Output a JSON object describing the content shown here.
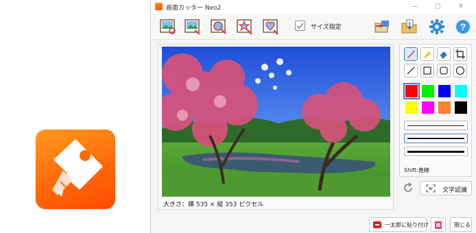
{
  "window": {
    "title": "画面カッター Neo2",
    "minimize_glyph": "—",
    "maximize_glyph": "▢",
    "close_glyph": "✕"
  },
  "toolbar": {
    "buttons": [
      {
        "name": "capture-screen-icon"
      },
      {
        "name": "capture-window-icon"
      },
      {
        "name": "capture-region-icon"
      },
      {
        "name": "capture-star-icon"
      },
      {
        "name": "capture-heart-icon"
      },
      {
        "name": "export-image-icon"
      },
      {
        "name": "save-folder-icon"
      },
      {
        "name": "settings-gear-icon"
      },
      {
        "name": "help-icon"
      }
    ],
    "size_fixed_label": "サイズ指定",
    "size_fixed_checked": true,
    "help_glyph": "?"
  },
  "preview": {
    "size_info": "大きさ：横 535 × 縦 353 ピクセル"
  },
  "panel": {
    "tools": [
      "pen-icon",
      "highlighter-icon",
      "eraser-icon",
      "crop-icon",
      "line-icon",
      "rectangle-icon",
      "rounded-rectangle-icon",
      "ellipse-icon"
    ],
    "colors": [
      "#ff0000",
      "#00ee00",
      "#0000ff",
      "#00ffff",
      "#ffff00",
      "#ff00ff",
      "#ff8033",
      "#000000"
    ],
    "selected_color": "#ff0000",
    "line_widths": [
      "thin",
      "medium",
      "thick"
    ],
    "selected_width": "medium",
    "shift_note": "Shift:直線"
  },
  "ocr": {
    "label": "文字認識"
  },
  "footer": {
    "paste_label": "一太郎に貼り付け",
    "close_label": "閉じる"
  },
  "colors": {
    "accent": "#3c7fd6",
    "brand": "#ff6a0a"
  }
}
